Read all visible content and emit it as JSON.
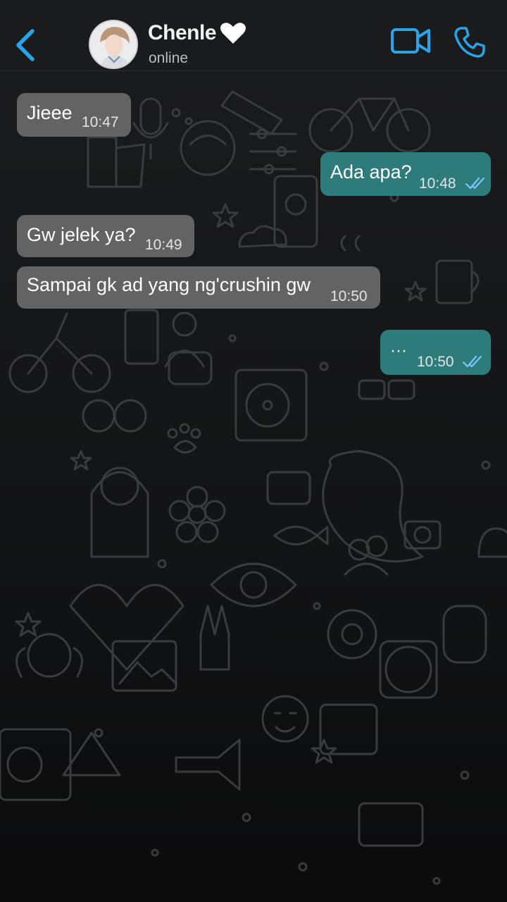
{
  "header": {
    "contact_name": "Chenle",
    "status": "online",
    "accent_color": "#2aa4e8"
  },
  "icons": {
    "back": "chevron-left-icon",
    "heart": "heart-icon",
    "video": "video-camera-icon",
    "call": "phone-icon",
    "read_receipt": "double-check-icon"
  },
  "messages": [
    {
      "direction": "incoming",
      "text": "Jieee",
      "time": "10:47"
    },
    {
      "direction": "outgoing",
      "text": "Ada apa?",
      "time": "10:48",
      "read": true
    },
    {
      "direction": "incoming",
      "text": "Gw jelek ya?",
      "time": "10:49"
    },
    {
      "direction": "incoming",
      "text": "Sampai gk ad yang ng'crushin gw",
      "time": "10:50"
    },
    {
      "direction": "outgoing",
      "text": "···",
      "time": "10:50",
      "read": true
    }
  ]
}
